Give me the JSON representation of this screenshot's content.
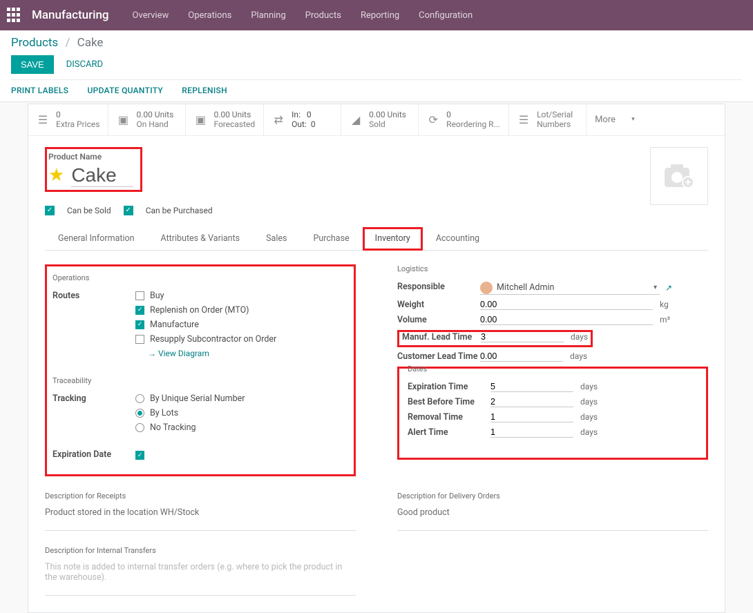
{
  "topbar": {
    "app": "Manufacturing",
    "nav": [
      "Overview",
      "Operations",
      "Planning",
      "Products",
      "Reporting",
      "Configuration"
    ]
  },
  "breadcrumb": {
    "products": "Products",
    "current": "Cake"
  },
  "buttons": {
    "save": "SAVE",
    "discard": "DISCARD"
  },
  "toolbar": {
    "print_labels": "PRINT LABELS",
    "update_qty": "UPDATE QUANTITY",
    "replenish": "REPLENISH"
  },
  "stats": {
    "extra_prices": {
      "val": "0",
      "lbl": "Extra Prices"
    },
    "on_hand": {
      "val": "0.00 Units",
      "lbl": "On Hand"
    },
    "forecast": {
      "val": "0.00 Units",
      "lbl": "Forecasted"
    },
    "inout": {
      "in_l": "In:",
      "in_v": "0",
      "out_l": "Out:",
      "out_v": "0"
    },
    "sold": {
      "val": "0.00 Units",
      "lbl": "Sold"
    },
    "reorder": {
      "val": "0",
      "lbl": "Reordering R..."
    },
    "lot": {
      "lbl1": "Lot/Serial",
      "lbl2": "Numbers"
    },
    "more": "More"
  },
  "product": {
    "name_lbl": "Product Name",
    "name": "Cake",
    "can_be_sold": "Can be Sold",
    "can_be_purchased": "Can be Purchased"
  },
  "tabs": [
    "General Information",
    "Attributes & Variants",
    "Sales",
    "Purchase",
    "Inventory",
    "Accounting"
  ],
  "operations": {
    "title": "Operations",
    "routes_lbl": "Routes",
    "routes": {
      "buy": "Buy",
      "mto": "Replenish on Order (MTO)",
      "manuf": "Manufacture",
      "resupply": "Resupply Subcontractor on Order"
    },
    "view_diag": "View Diagram",
    "trace_title": "Traceability",
    "tracking_lbl": "Tracking",
    "tracking": {
      "serial": "By Unique Serial Number",
      "lots": "By Lots",
      "none": "No Tracking"
    },
    "exp_date_lbl": "Expiration Date"
  },
  "logistics": {
    "title": "Logistics",
    "responsible_lbl": "Responsible",
    "responsible": "Mitchell Admin",
    "weight_lbl": "Weight",
    "weight": "0.00",
    "weight_u": "kg",
    "volume_lbl": "Volume",
    "volume": "0.00",
    "volume_u": "m³",
    "manuf_lt_lbl": "Manuf. Lead Time",
    "manuf_lt": "3",
    "days": "days",
    "cust_lt_lbl": "Customer Lead Time",
    "cust_lt": "0.00"
  },
  "dates": {
    "title": "Dates",
    "exp_lbl": "Expiration Time",
    "exp": "5",
    "bb_lbl": "Best Before Time",
    "bb": "2",
    "rem_lbl": "Removal Time",
    "rem": "1",
    "al_lbl": "Alert Time",
    "al": "1",
    "days": "days"
  },
  "desc": {
    "receipts_ttl": "Description for Receipts",
    "receipts_txt": "Product stored in the location  WH/Stock",
    "delivery_ttl": "Description for Delivery Orders",
    "delivery_txt": "Good product",
    "internal_ttl": "Description for Internal Transfers",
    "internal_ph": "This note is added to internal transfer orders (e.g. where to pick the product in the warehouse)."
  }
}
